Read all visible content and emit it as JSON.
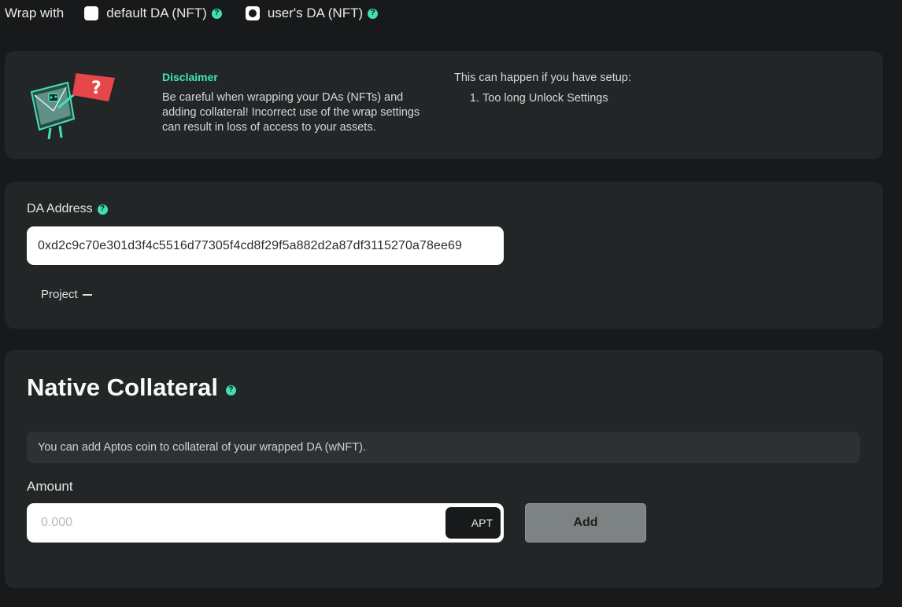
{
  "wrap": {
    "label": "Wrap with",
    "options": [
      {
        "label": "default DA (NFT)",
        "checked": false
      },
      {
        "label": "user's DA (NFT)",
        "checked": true
      }
    ],
    "help_glyph": "?"
  },
  "disclaimer": {
    "title": "Disclaimer",
    "text": "Be careful when wrapping your DAs (NFTs) and adding collateral! Incorrect use of the wrap settings can result in loss of access to your assets.",
    "right_intro": "This can happen if you have setup:",
    "right_items": [
      "Too long Unlock Settings"
    ],
    "art_glyph": "?"
  },
  "da_address": {
    "label": "DA Address",
    "value": "0xd2c9c70e301d3f4c5516d77305f4cd8f29f5a882d2a87df3115270a78ee69",
    "project_label": "Project"
  },
  "collateral": {
    "title": "Native Collateral",
    "note": "You can add Aptos coin to collateral of your wrapped DA (wNFT).",
    "amount_label": "Amount",
    "amount_placeholder": "0.000",
    "currency": "APT",
    "add_label": "Add"
  },
  "colors": {
    "accent": "#3fe6b4",
    "background": "#17191a",
    "card": "#222627"
  }
}
